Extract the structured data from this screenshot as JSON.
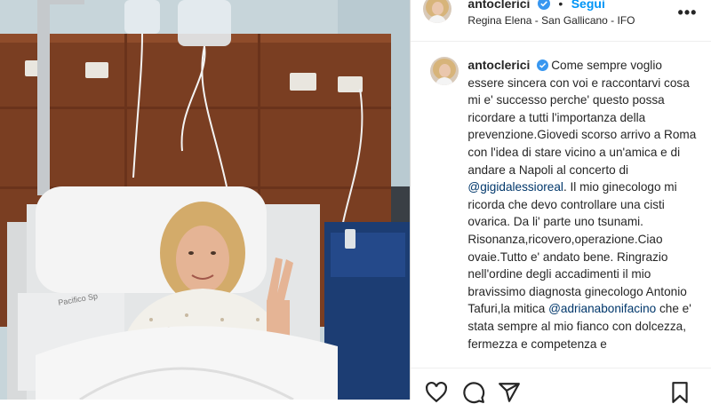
{
  "author": {
    "username": "antoclerici",
    "verified": true,
    "follow_label": "Segui",
    "location": "Regina Elena - San Gallicano - IFO"
  },
  "caption": {
    "username": "antoclerici",
    "text_part1": "Come sempre voglio essere sincera con voi e raccontarvi cosa mi e' successo perche' questo possa ricordare a tutti l'importanza della prevenzione.Giovedi scorso arrivo a Roma con l'idea di stare vicino a un'amica e di andare a Napoli al concerto di ",
    "mention1": "@gigidalessioreal",
    "text_part2": ". Il mio ginecologo mi ricorda che devo controllare una cisti ovarica. Da li' parte uno tsunami. Risonanza,ricovero,operazione.Ciao ovaie.Tutto e' andato bene. Ringrazio nell'ordine degli accadimenti il mio bravissimo diagnosta ginecologo Antonio Tafuri,la mitica ",
    "mention2": "@adrianabonifacino",
    "text_part3": " che e' stata sempre al mio fianco con dolcezza, fermezza e competenza e"
  },
  "icons": {
    "more": "more-options-icon",
    "like": "heart-icon",
    "comment": "comment-icon",
    "share": "share-icon",
    "save": "bookmark-icon"
  },
  "colors": {
    "link": "#0095f6",
    "mention": "#00376b",
    "verified": "#3897f0"
  },
  "photo": {
    "icons": {
      "wall_sign": "wall-sign"
    },
    "sign_text": "Pacifico Sp"
  }
}
